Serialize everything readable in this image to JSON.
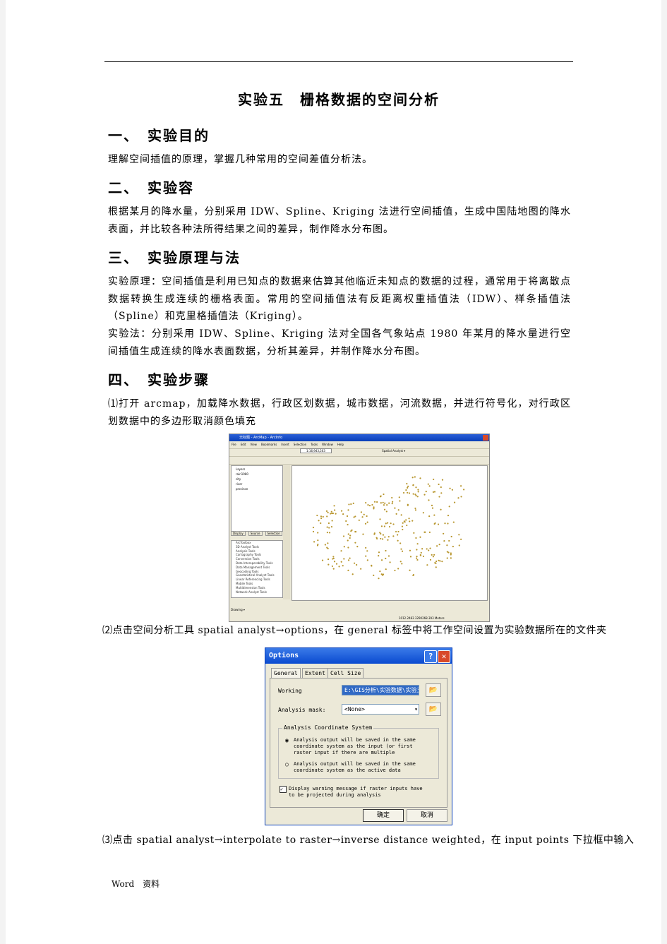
{
  "title": "实验五　栅格数据的空间分析",
  "sections": [
    {
      "heading": "一、　实验目的",
      "paragraphs": [
        "理解空间插值的原理，掌握几种常用的空间差值分析法。"
      ]
    },
    {
      "heading": "二、　实验容",
      "paragraphs": [
        "根据某月的降水量，分别采用 IDW、Spline、Kriging 法进行空间插值，生成中国陆地图的降水表面，并比较各种法所得结果之间的差异，制作降水分布图。"
      ]
    },
    {
      "heading": "三、　实验原理与法",
      "paragraphs": [
        "实验原理：空间插值是利用已知点的数据来估算其他临近未知点的数据的过程，通常用于将离散点数据转换生成连续的栅格表面。常用的空间插值法有反距离权重插值法（IDW）、样条插值法（Spline）和克里格插值法（Kriging）。",
        "实验法：分别采用 IDW、Spline、Kriging 法对全国各气象站点 1980 年某月的降水量进行空间插值生成连续的降水表面数据，分析其差异，并制作降水分布图。"
      ]
    },
    {
      "heading": "四、　实验步骤",
      "paragraphs": []
    }
  ],
  "steps": [
    "⑴打开 arcmap，加载降水数据，行政区划数据，城市数据，河流数据，并进行符号化，对行政区划数据中的多边形取消颜色填充",
    "⑵点击空间分析工具 spatial analyst→options，在 general 标签中将工作空间设置为实验数据所在的文件夹",
    "⑶点击 spatial analyst→interpolate to raster→inverse distance weighted，在 input points 下拉框中输入"
  ],
  "arcmap": {
    "title": "无标题 - ArcMap - ArcInfo",
    "menu": [
      "File",
      "Edit",
      "View",
      "Bookmarks",
      "Insert",
      "Selection",
      "Tools",
      "Window",
      "Help"
    ],
    "scale": "1:16,943,503",
    "spatial_analyst": "Spatial Analyst ▾",
    "layers": [
      "Layers",
      "rain1980",
      "city",
      "river",
      "province"
    ],
    "toc_tabs": [
      "Display",
      "Source",
      "Selection"
    ],
    "toolbox": [
      "ArcToolbox",
      "3D Analyst Tools",
      "Analysis Tools",
      "Cartography Tools",
      "Conversion Tools",
      "Data Interoperability Tools",
      "Data Management Tools",
      "Geocoding Tools",
      "Geostatistical Analyst Tools",
      "Linear Referencing Tools",
      "Mobile Tools",
      "Multidimension Tools",
      "Network Analyst Tools"
    ],
    "toolbox_tabs": [
      "Favorites",
      "Index",
      "Search"
    ],
    "drawing": "Drawing ▾",
    "status": "1012.2483  3290268.393 Meters"
  },
  "options_dialog": {
    "title": "Options",
    "tabs": [
      "General",
      "Extent",
      "Cell Size"
    ],
    "working_label": "Working",
    "working_value": "E:\\GIS分析\\实验数据\\实验五\\",
    "mask_label": "Analysis mask:",
    "mask_value": "<None>",
    "group": "Analysis Coordinate System",
    "radio1": "Analysis output will be saved in the same coordinate system as the input (or first raster input if there are multiple",
    "radio2": "Analysis output will be saved in the same coordinate system as the active data",
    "checkbox": "Display warning message if raster inputs have to be projected during analysis",
    "ok": "确定",
    "cancel": "取消"
  },
  "footer": "Word　资料"
}
